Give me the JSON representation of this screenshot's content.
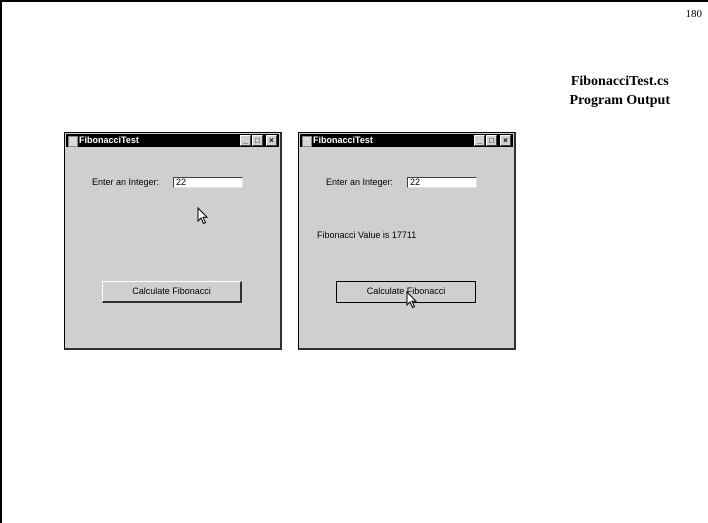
{
  "slide": {
    "page_number": "180",
    "title_line1": "FibonacciTest.cs",
    "title_line2": "Program Output"
  },
  "windows": [
    {
      "title": "FibonacciTest",
      "input_label": "Enter an Integer:",
      "input_value": "22",
      "result_text": "",
      "button_label": "Calculate Fibonacci"
    },
    {
      "title": "FibonacciTest",
      "input_label": "Enter an Integer:",
      "input_value": "22",
      "result_text": "Fibonacci Value is 17711",
      "button_label": "Calculate Fibonacci"
    }
  ],
  "caption_buttons": {
    "minimize": "_",
    "maximize": "□",
    "close": "×"
  },
  "icons": [
    "app-icon",
    "minimize-icon",
    "maximize-icon",
    "close-icon",
    "mouse-cursor-icon"
  ]
}
